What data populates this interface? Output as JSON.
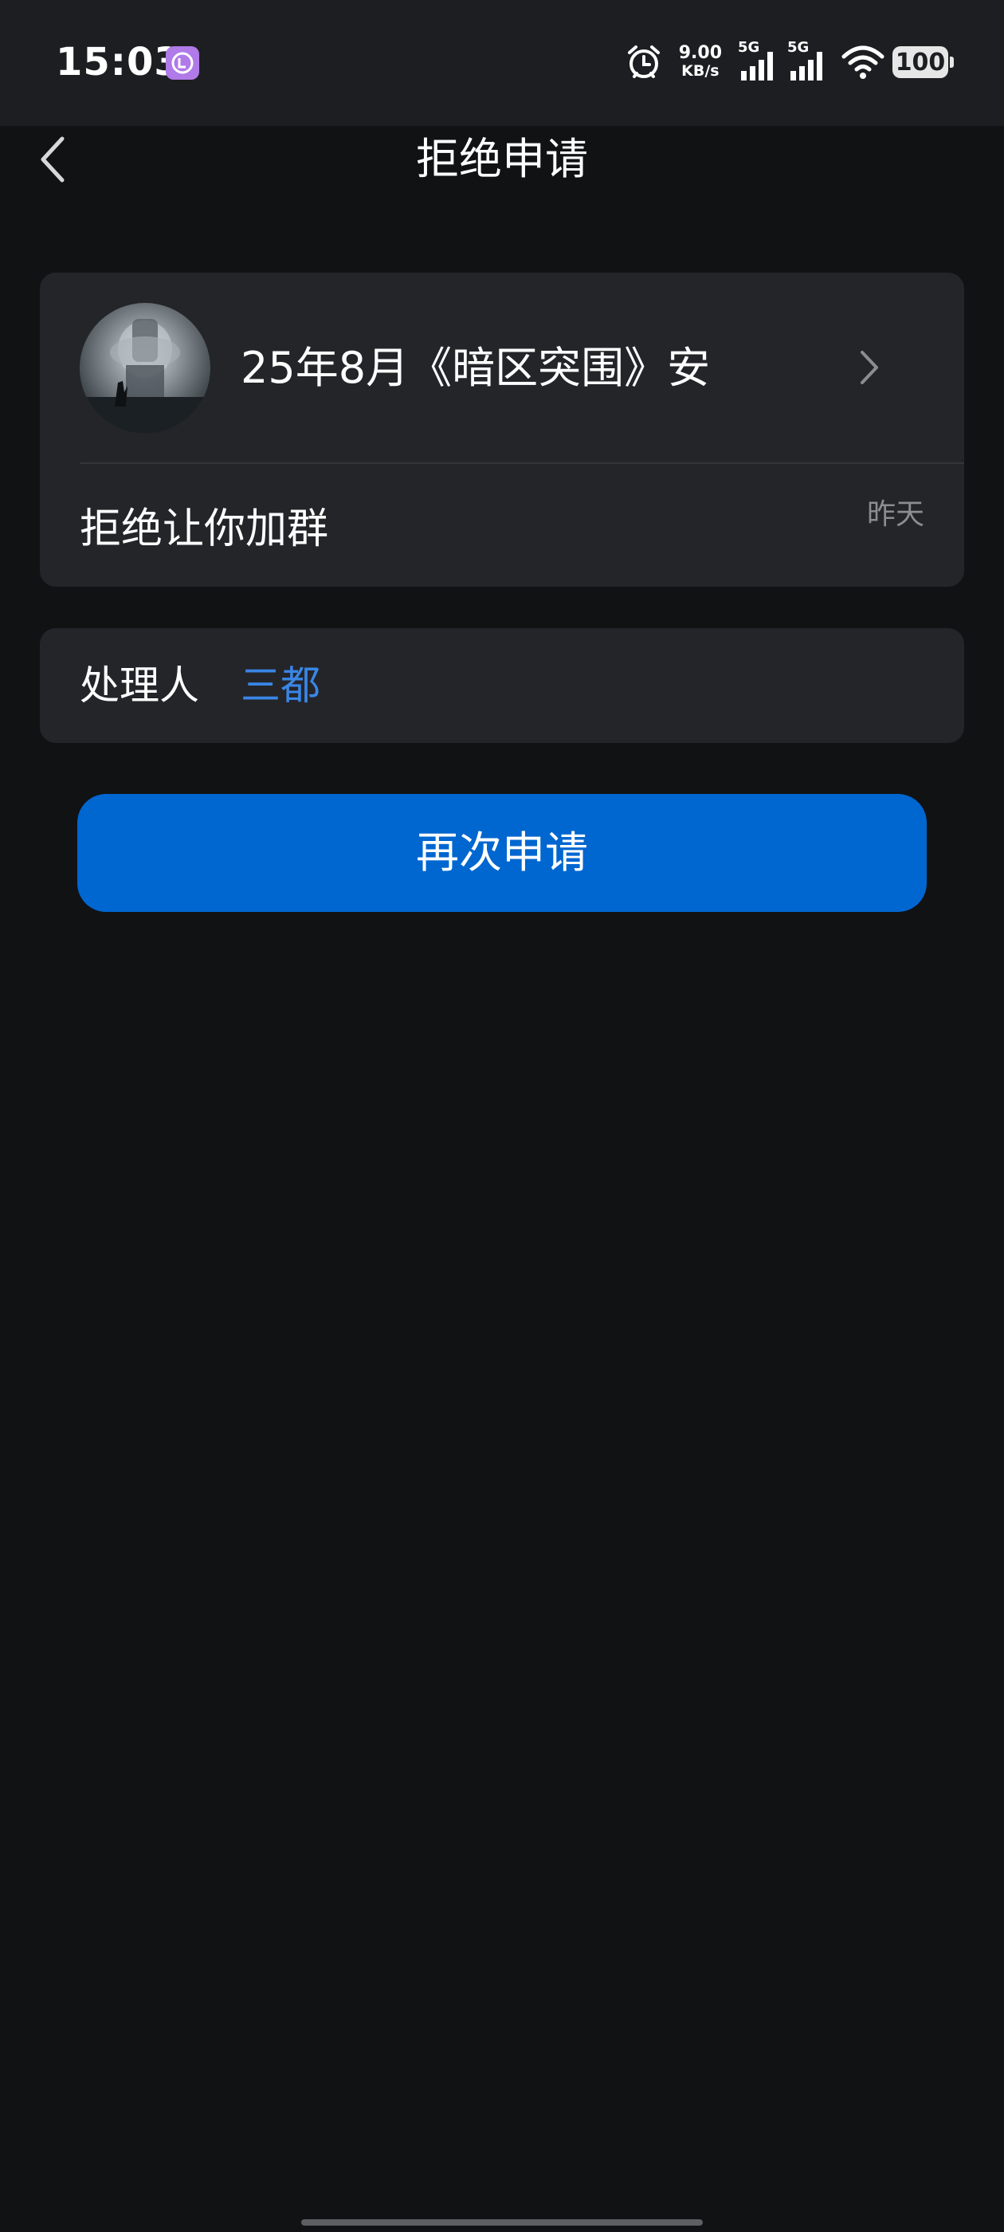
{
  "status_bar": {
    "time": "15:03",
    "net_speed_value": "9.00",
    "net_speed_unit": "KB/s",
    "sim1_label": "5G",
    "sim2_label": "5G",
    "battery": "100",
    "icons": [
      "app-notification-icon",
      "alarm-icon",
      "signal-icon",
      "signal-icon",
      "wifi-icon",
      "battery-icon"
    ]
  },
  "header": {
    "title": "拒绝申请",
    "back_icon": "chevron-left-icon"
  },
  "group_card": {
    "group_name": "25年8月《暗区突围》安",
    "message": "拒绝让你加群",
    "time": "昨天",
    "chevron_icon": "chevron-right-icon"
  },
  "handler_card": {
    "label": "处理人",
    "name": "三都",
    "name_color": "#3a86e6"
  },
  "actions": {
    "reapply_label": "再次申请",
    "button_color": "#0066d0"
  }
}
